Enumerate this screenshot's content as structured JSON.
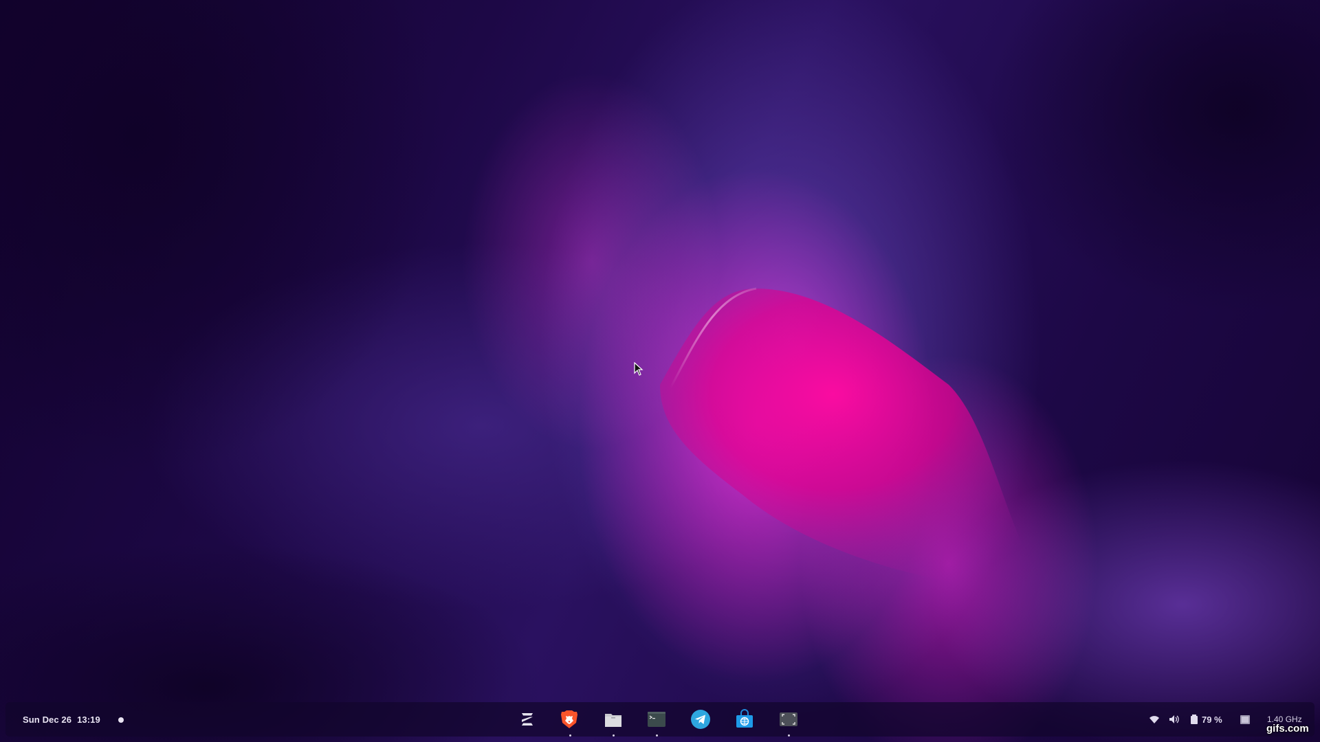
{
  "panel": {
    "date": "Sun Dec 26",
    "time": "13:19"
  },
  "dock": {
    "apps": [
      {
        "name": "Zorin Menu",
        "icon": "zorin-logo-icon",
        "running": false
      },
      {
        "name": "Brave",
        "icon": "brave-lion-icon",
        "running": true
      },
      {
        "name": "Files",
        "icon": "folder-icon",
        "running": true
      },
      {
        "name": "Terminal",
        "icon": "terminal-icon",
        "running": true
      },
      {
        "name": "Telegram",
        "icon": "telegram-icon",
        "running": false
      },
      {
        "name": "Software",
        "icon": "software-store-icon",
        "running": false
      },
      {
        "name": "Screenshot",
        "icon": "screenshot-icon",
        "running": true
      }
    ]
  },
  "tray": {
    "battery_percent": "79 %",
    "cpu_freq": "1.40 GHz",
    "icons": [
      "wifi-icon",
      "volume-icon",
      "battery-icon",
      "display-icon"
    ]
  },
  "overlay": {
    "watermark": "gifs.com"
  },
  "colors": {
    "wallpaper_accent": "#e8008c",
    "wallpaper_base": "#1d0846",
    "panel_bg": "#12062c"
  }
}
